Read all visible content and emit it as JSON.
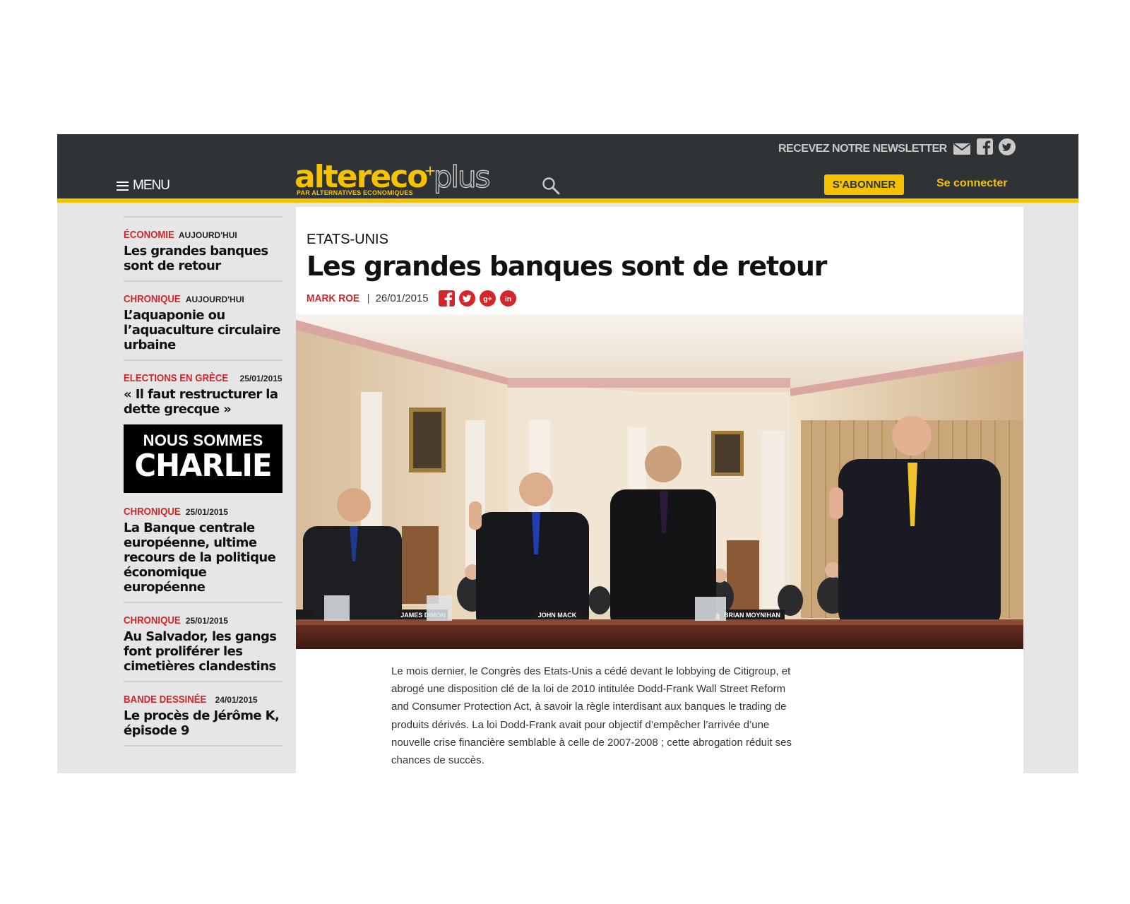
{
  "header": {
    "menu_label": "MENU",
    "logo": {
      "main": "altereco",
      "plus_sign": "+",
      "plus": "plus",
      "tagline": "PAR ALTERNATIVES ECONOMIQUES"
    },
    "newsletter_label": "RECEVEZ NOTRE NEWSLETTER",
    "subscribe_label": "S'ABONNER",
    "login_label": "Se connecter",
    "icons": [
      "hamburger-icon",
      "search-icon",
      "envelope-icon",
      "facebook-icon",
      "twitter-icon"
    ]
  },
  "sidebar": {
    "items": [
      {
        "category": "ÉCONOMIE",
        "date": "AUJOURD'HUI",
        "title": "Les grandes banques sont de retour"
      },
      {
        "category": "CHRONIQUE",
        "date": "AUJOURD'HUI",
        "title": "L’aquaponie ou l’aquaculture circulaire urbaine"
      },
      {
        "category": "ELECTIONS EN GRÈCE",
        "date": "25/01/2015",
        "title": "« Il faut restructurer la dette grecque »"
      },
      {
        "category": "CHRONIQUE",
        "date": "25/01/2015",
        "title": "La Banque centrale européenne, ultime recours de la politique économique européenne"
      },
      {
        "category": "CHRONIQUE",
        "date": "25/01/2015",
        "title": "Au Salvador, les gangs font proliférer les cimetières clandestins"
      },
      {
        "category": "BANDE DESSINÉE",
        "date": "24/01/2015",
        "title": "Le procès de Jérôme K, épisode 9"
      }
    ],
    "banner": {
      "line1": "NOUS SOMMES",
      "line2": "CHARLIE"
    }
  },
  "article": {
    "kicker": "ETATS-UNIS",
    "title": "Les grandes banques sont de retour",
    "author": "MARK ROE",
    "separator": "|",
    "date": "26/01/2015",
    "share_icons": [
      "facebook-icon",
      "twitter-icon",
      "google-plus-icon",
      "linkedin-icon"
    ],
    "photo_nameplates": [
      "JAMES DIMON",
      "JOHN MACK",
      "BRIAN MOYNIHAN"
    ],
    "body": "Le mois dernier, le Congrès des Etats-Unis a cédé devant le lobbying de Citigroup, et abrogé une disposition clé de la loi de 2010 intitulée Dodd-Frank Wall Street Reform and Consumer Protection Act, à savoir la règle interdisant aux banques le trading de produits dérivés. La loi Dodd-Frank avait pour objectif d’empêcher l’arrivée d’une nouvelle crise financière semblable à celle de 2007-2008 ; cette abrogation réduit ses chances de succès."
  },
  "colors": {
    "header_bg": "#2f3336",
    "accent_yellow": "#f5c200",
    "category_red": "#d4262a",
    "sidebar_bg": "#e6e6e6"
  }
}
